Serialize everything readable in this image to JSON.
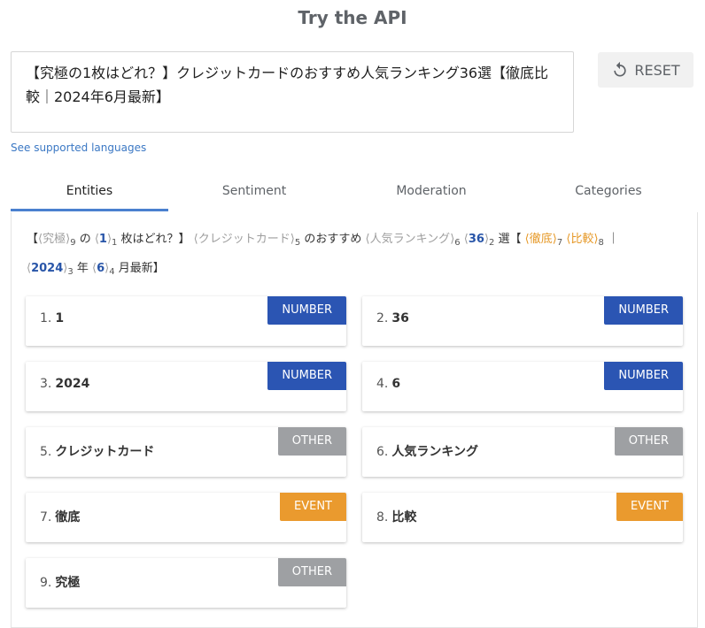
{
  "header": {
    "title": "Try the API"
  },
  "input": {
    "text": "【究極の1枚はどれ？】クレジットカードのおすすめ人気ランキング36選【徹底比較｜2024年6月最新】"
  },
  "reset": {
    "label": "RESET"
  },
  "links": {
    "supported_languages": "See supported languages"
  },
  "tabs": [
    {
      "label": "Entities",
      "active": true
    },
    {
      "label": "Sentiment",
      "active": false
    },
    {
      "label": "Moderation",
      "active": false
    },
    {
      "label": "Categories",
      "active": false
    }
  ],
  "annotated": {
    "t0": "【",
    "e_kyukyoku": "究極",
    "s_kyukyoku": "9",
    "t1": " の ",
    "e_1": "1",
    "s_1": "1",
    "t2": " 枚はどれ？】 ",
    "e_card": "クレジットカード",
    "s_card": "5",
    "t3": " のおすすめ ",
    "e_rank": "人気ランキング",
    "s_rank": "6",
    "e_36": "36",
    "s_36": "2",
    "t4": " 選【 ",
    "e_tettei": "徹底",
    "s_tettei": "7",
    "e_hikaku": "比較",
    "s_hikaku": "8",
    "t5": " ｜",
    "e_2024": "2024",
    "s_2024": "3",
    "t6": " 年 ",
    "e_6": "6",
    "s_6": "4",
    "t7": " 月最新】"
  },
  "entities": [
    {
      "index": "1.",
      "name": "1",
      "type": "NUMBER"
    },
    {
      "index": "2.",
      "name": "36",
      "type": "NUMBER"
    },
    {
      "index": "3.",
      "name": "2024",
      "type": "NUMBER"
    },
    {
      "index": "4.",
      "name": "6",
      "type": "NUMBER"
    },
    {
      "index": "5.",
      "name": "クレジットカード",
      "type": "OTHER"
    },
    {
      "index": "6.",
      "name": "人気ランキング",
      "type": "OTHER"
    },
    {
      "index": "7.",
      "name": "徹底",
      "type": "EVENT"
    },
    {
      "index": "8.",
      "name": "比較",
      "type": "EVENT"
    },
    {
      "index": "9.",
      "name": "究極",
      "type": "OTHER"
    }
  ],
  "colors": {
    "number": "#2b55b3",
    "other": "#9ea0a3",
    "event": "#ea9a2e",
    "tab_accent": "#4a80cf"
  }
}
